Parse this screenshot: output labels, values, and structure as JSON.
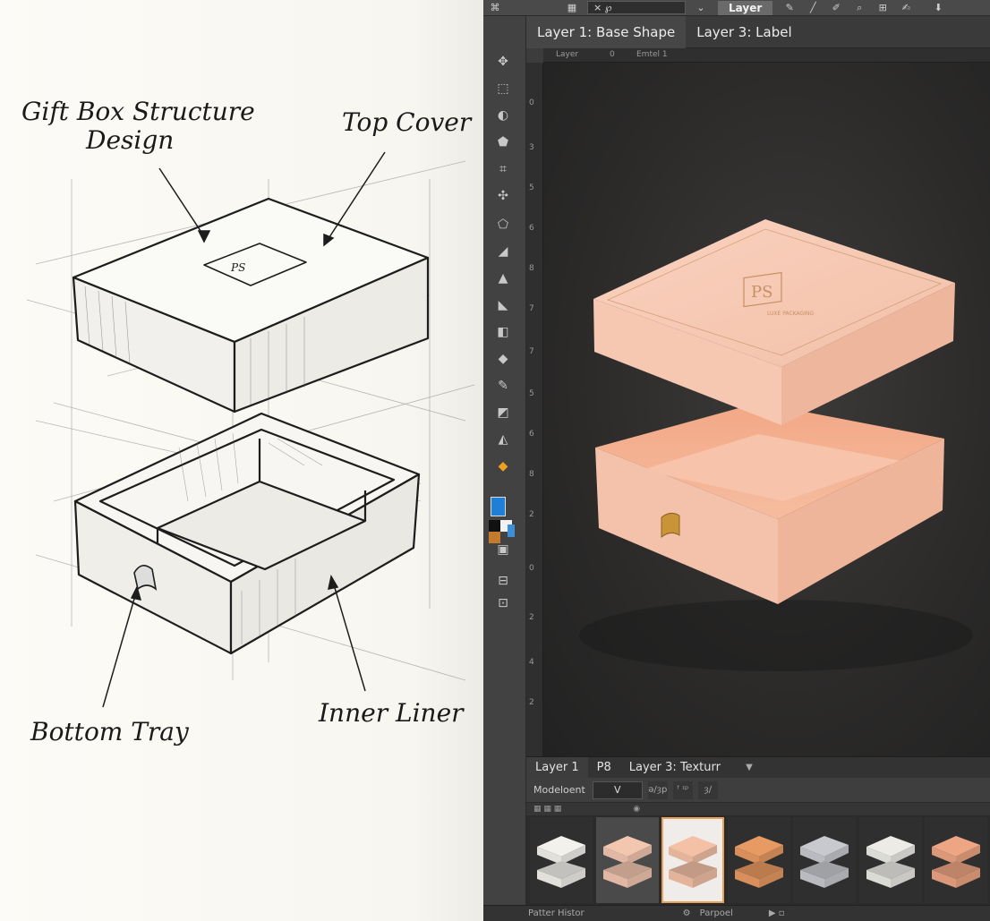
{
  "sketch": {
    "title_line1": "Gift Box Structure",
    "title_line2": "Design",
    "label_top_cover": "Top Cover",
    "label_bottom_tray": "Bottom Tray",
    "label_inner_liner": "Inner Liner",
    "lid_emblem": "PS"
  },
  "app": {
    "options_bar": {
      "field_value": "× ℘",
      "label": "Layer"
    },
    "document_tabs": [
      "Layer 1: Base Shape",
      "Layer 3: Label"
    ],
    "ruler_top_labels": [
      "Layer",
      "0",
      "Emtel 1"
    ],
    "ruler_left_marks": [
      "0",
      "3",
      "5",
      "6",
      "8",
      "7",
      "7",
      "5",
      "6",
      "8",
      "2",
      "0",
      "2",
      "4",
      "2"
    ],
    "canvas": {
      "lid_emblem": "PS",
      "lid_subtext": "LUXE PACKAGING"
    },
    "layers_tabs": [
      "Layer 1",
      "P8",
      "Layer 3: Texturr"
    ],
    "blend_label": "Modeloent",
    "blend_value": "V",
    "prop_icons": [
      "ǝ/ȝp",
      "ᶠ ᶦᵖ",
      "ȝ/"
    ],
    "swatch_colors": [
      "#f3f1ec",
      "#f3c6b0",
      "#f4c1a6",
      "#e89a63",
      "#c8c9ce",
      "#ecebe6",
      "#eda583"
    ],
    "selected_swatch": 2,
    "status_left": "Patter Histor",
    "status_right": "Parpoel"
  },
  "colors": {
    "accent": "#e6a25a",
    "box_pink": "#f4c2ab",
    "canvas_bg": "#2b2a29",
    "panel_bg": "#3c3c3c"
  }
}
